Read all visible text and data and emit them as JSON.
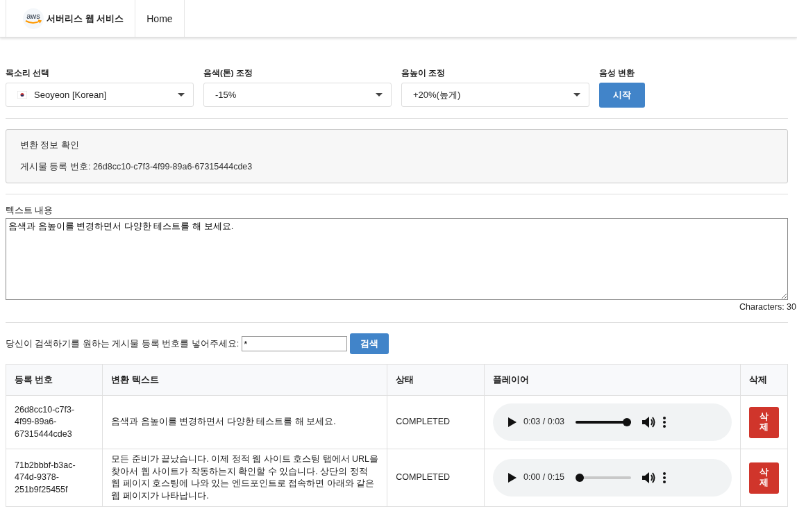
{
  "nav": {
    "brand": "서버리스 웹 서비스",
    "logo_text": "aws",
    "links": [
      {
        "label": "Home"
      }
    ]
  },
  "controls": {
    "voice": {
      "label": "목소리 선택",
      "value": "Seoyeon [Korean]"
    },
    "tone": {
      "label": "음색(톤) 조정",
      "value": "-15%"
    },
    "pitch": {
      "label": "음높이 조정",
      "value": "+20%(높게)"
    },
    "convert": {
      "label": "음성 변환",
      "button": "시작"
    }
  },
  "info": {
    "title": "변환 정보 확인",
    "line": "게시물 등록 번호: 26d8cc10-c7f3-4f99-89a6-67315444cde3"
  },
  "text": {
    "label": "텍스트 내용",
    "value": "음색과 음높이를 변경하면서 다양한 테스트를 해 보세요.",
    "count": "Characters: 30"
  },
  "search": {
    "label": "당신이 검색하기를 원하는 게시물 등록 번호를 넣어주세요:",
    "value": "*",
    "button": "검색"
  },
  "table": {
    "columns": [
      "등록 번호",
      "변환 텍스트",
      "상태",
      "플레이어",
      "삭제"
    ],
    "rows": [
      {
        "id": "26d8cc10-c7f3-4f99-89a6-67315444cde3",
        "text": "음색과 음높이를 변경하면서 다양한 테스트를 해 보세요.",
        "status": "COMPLETED",
        "time": "0:03 / 0:03",
        "level": 1,
        "delete": "삭제"
      },
      {
        "id": "71b2bbbf-b3ac-474d-9378-251b9f25455f",
        "text": "모든 준비가 끝났습니다. 이제 정적 웹 사이트 호스팅 탭에서 URL을 찾아서 웹 사이트가 작동하는지 확인할 수 있습니다. 상단의 정적 웹 페이지 호스팅에 나와 있는 엔드포인트로 접속하면 아래와 같은 웹 페이지가 나타납니다.",
        "status": "COMPLETED",
        "time": "0:00 / 0:15",
        "level": 0,
        "delete": "삭제"
      }
    ]
  }
}
